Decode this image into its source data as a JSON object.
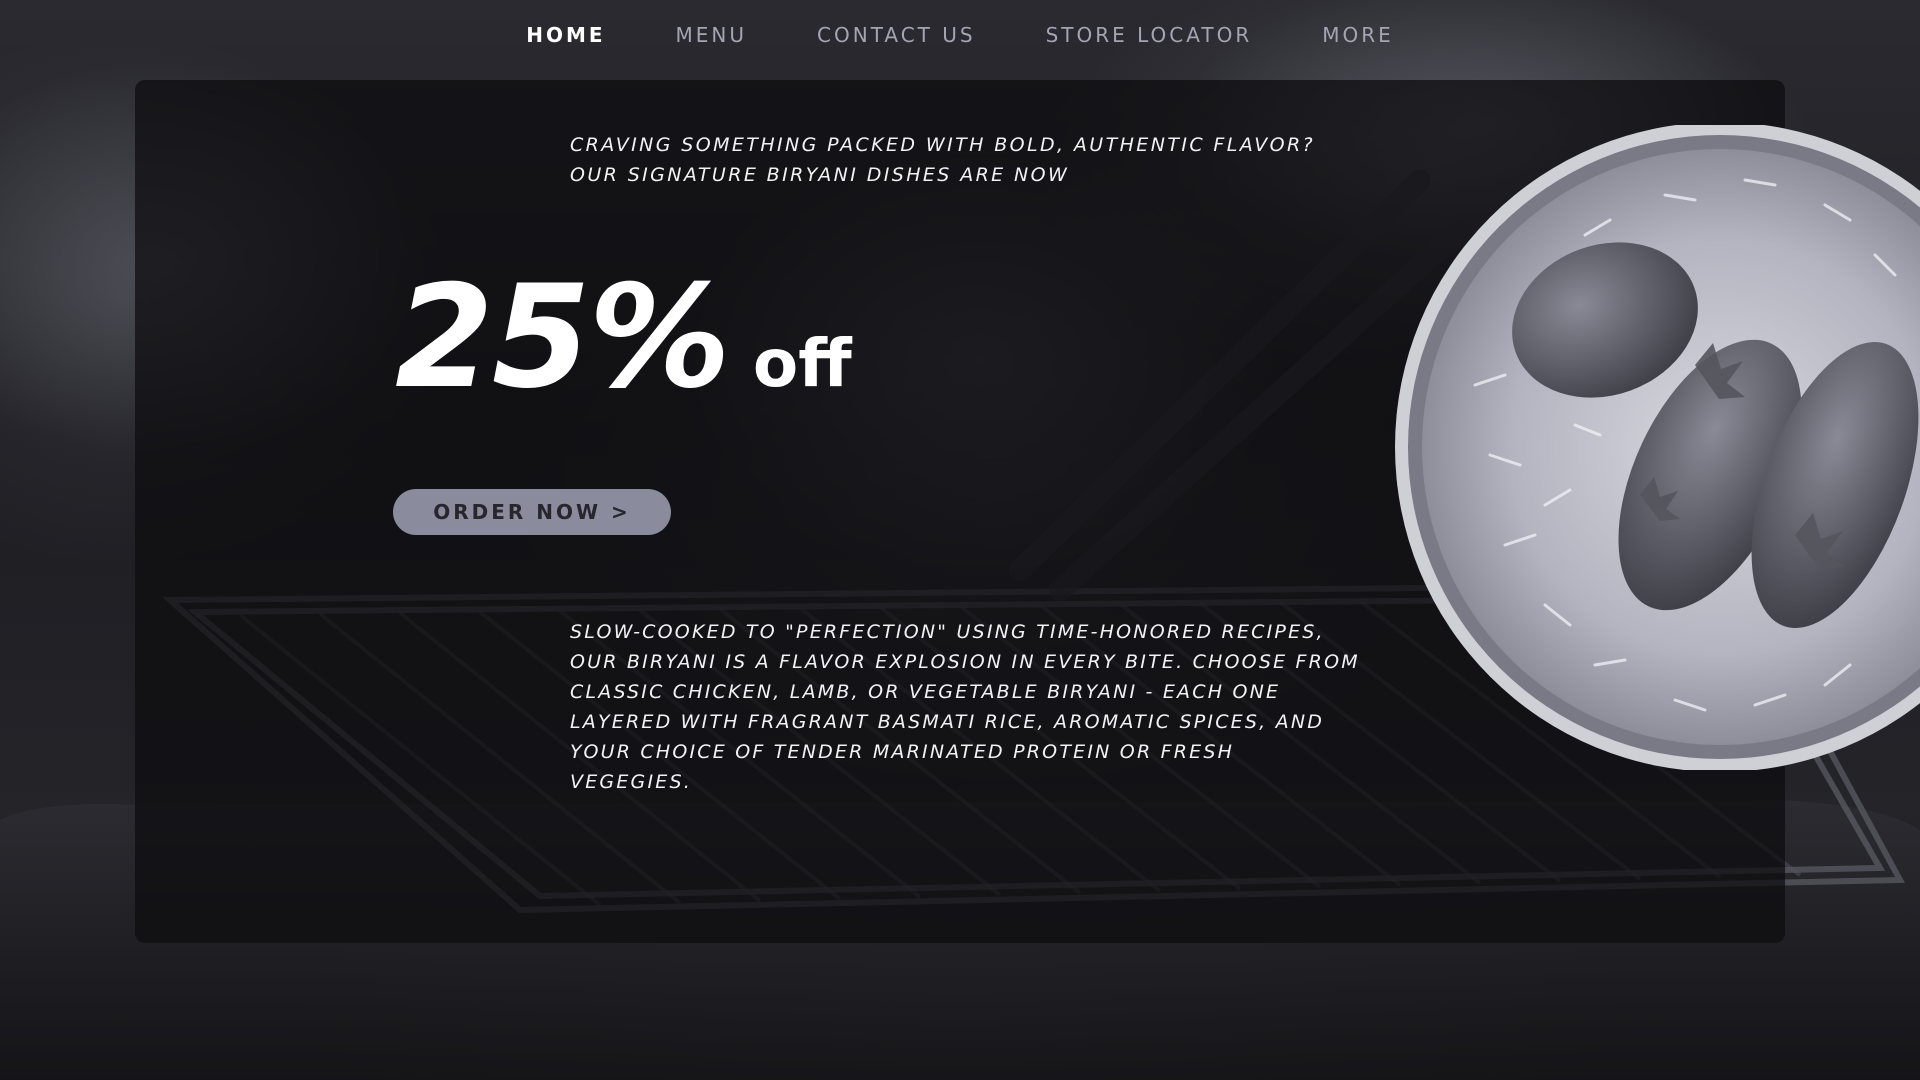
{
  "nav": {
    "items": [
      {
        "label": "HOME",
        "active": true
      },
      {
        "label": "MENU",
        "active": false
      },
      {
        "label": "CONTACT US",
        "active": false
      },
      {
        "label": "STORE LOCATOR",
        "active": false
      },
      {
        "label": "MORE",
        "active": false
      }
    ]
  },
  "hero": {
    "intro": "CRAVING SOMETHING PACKED WITH BOLD, AUTHENTIC FLAVOR? OUR SIGNATURE BIRYANI DISHES ARE NOW",
    "discount_value": "25%",
    "discount_suffix": "off",
    "order_button_label": "ORDER NOW >",
    "description": "SLOW-COOKED TO \"PERFECTION\" USING TIME-HONORED RECIPES, OUR BIRYANI IS A FLAVOR EXPLOSION IN EVERY BITE. CHOOSE FROM CLASSIC CHICKEN, LAMB, OR VEGETABLE BIRYANI - EACH ONE LAYERED WITH FRAGRANT BASMATI RICE, AROMATIC SPICES, AND YOUR CHOICE OF TENDER MARINATED PROTEIN OR FRESH VEGEGIES."
  },
  "colors": {
    "nav_inactive": "#a4a5b2",
    "nav_active": "#ffffff",
    "button_bg": "#8a8b9c",
    "button_text": "#26262c",
    "panel_bg": "rgba(12,12,15,0.72)"
  },
  "images": {
    "background": "smoky-grill-photo",
    "dish": "chicken-biryani-bowl"
  }
}
